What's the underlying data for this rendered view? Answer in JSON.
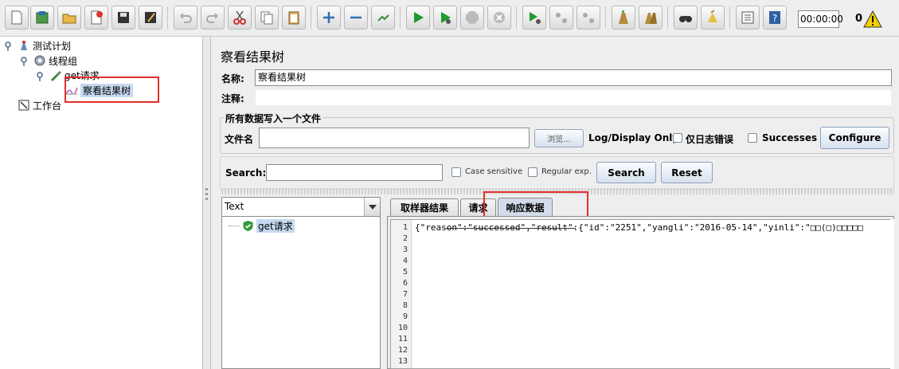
{
  "toolbar": {
    "buttons": [
      "new",
      "templates",
      "open",
      "close",
      "save",
      "save-as",
      "undo",
      "redo",
      "cut",
      "copy",
      "paste",
      "expand",
      "collapse",
      "toggle",
      "start",
      "start-no-pauses",
      "stop",
      "shutdown",
      "remote-start",
      "remote-stop",
      "remote-exit",
      "clear",
      "clear-all",
      "search",
      "reset-search",
      "function-helper",
      "help"
    ],
    "timer": "00:00:00",
    "error_count": "0"
  },
  "tree": {
    "test_plan": "测试计划",
    "thread_group": "线程组",
    "sampler": "get请求",
    "listener": "察看结果树",
    "workbench": "工作台"
  },
  "panel": {
    "title": "察看结果树",
    "name_label": "名称:",
    "name_value": "察看结果树",
    "comment_label": "注释:",
    "comment_value": ""
  },
  "file_group": {
    "title": "所有数据写入一个文件",
    "filename_label": "文件名",
    "filename_value": "",
    "browse_label": "浏览...",
    "log_display_label": "Log/Display Only:",
    "errors_only_label": "仅日志错误",
    "successes_label": "Successes",
    "configure_label": "Configure"
  },
  "search_bar": {
    "label": "Search:",
    "value": "",
    "case_sensitive_label": "Case sensitive",
    "regex_label": "Regular exp.",
    "search_button": "Search",
    "reset_button": "Reset"
  },
  "results": {
    "renderer": "Text",
    "items": [
      "get请求"
    ],
    "tabs": [
      "取样器结果",
      "请求",
      "响应数据"
    ],
    "active_tab": "响应数据",
    "line_numbers": [
      "1",
      "2",
      "3",
      "4",
      "5",
      "6",
      "7",
      "8",
      "9",
      "10",
      "11",
      "12",
      "13"
    ],
    "response_text": "{\"reason\":\"successed\",\"result\":{\"id\":\"2251\",\"yangli\":\"2016-05-14\",\"yinli\":\"□□(□)□□□□□"
  },
  "colors": {
    "highlight_box": "#e0302b",
    "selection": "#c6d9f0",
    "background": "#eeeeee"
  }
}
